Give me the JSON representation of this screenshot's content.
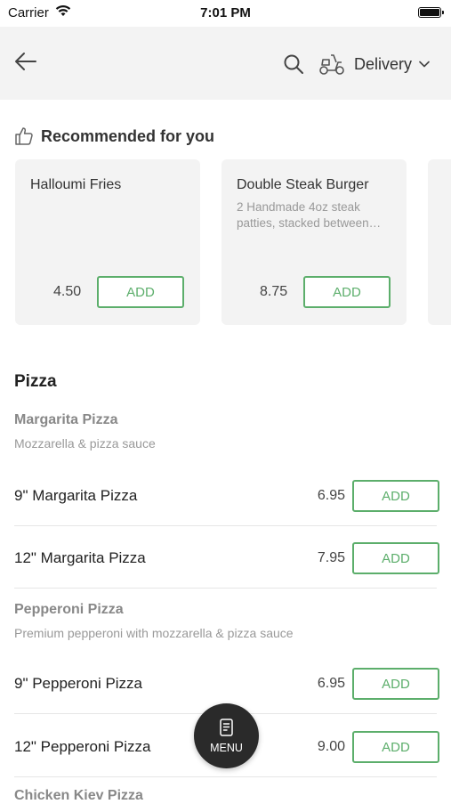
{
  "status_bar": {
    "carrier": "Carrier",
    "time": "7:01 PM"
  },
  "header": {
    "icons": [
      "back-arrow-icon",
      "search-icon",
      "scooter-icon",
      "chevron-down-icon"
    ],
    "delivery_label": "Delivery"
  },
  "recommended": {
    "title": "Recommended for you",
    "icon": "thumbs-up-icon",
    "items": [
      {
        "name": "Halloumi Fries",
        "description": "",
        "price": "4.50",
        "add_label": "ADD"
      },
      {
        "name": "Double Steak Burger",
        "description": "2 Handmade 4oz steak patties, stacked between…",
        "price": "8.75",
        "add_label": "ADD"
      }
    ]
  },
  "menu": {
    "section_title": "Pizza",
    "groups": [
      {
        "title": "Margarita Pizza",
        "description": "Mozzarella & pizza sauce",
        "items": [
          {
            "name": "9\" Margarita Pizza",
            "price": "6.95",
            "add_label": "ADD"
          },
          {
            "name": "12\" Margarita Pizza",
            "price": "7.95",
            "add_label": "ADD"
          }
        ]
      },
      {
        "title": "Pepperoni Pizza",
        "description": "Premium pepperoni with mozzarella & pizza sauce",
        "items": [
          {
            "name": "9\" Pepperoni Pizza",
            "price": "6.95",
            "add_label": "ADD"
          },
          {
            "name": "12\" Pepperoni Pizza",
            "price": "9.00",
            "add_label": "ADD"
          }
        ]
      },
      {
        "title": "Chicken Kiev Pizza"
      }
    ]
  },
  "fab": {
    "label": "MENU",
    "icon": "menu-book-icon"
  },
  "colors": {
    "accent": "#5cae6b",
    "header_bg": "#f3f3f3",
    "fab_bg": "#2a2a2a"
  }
}
